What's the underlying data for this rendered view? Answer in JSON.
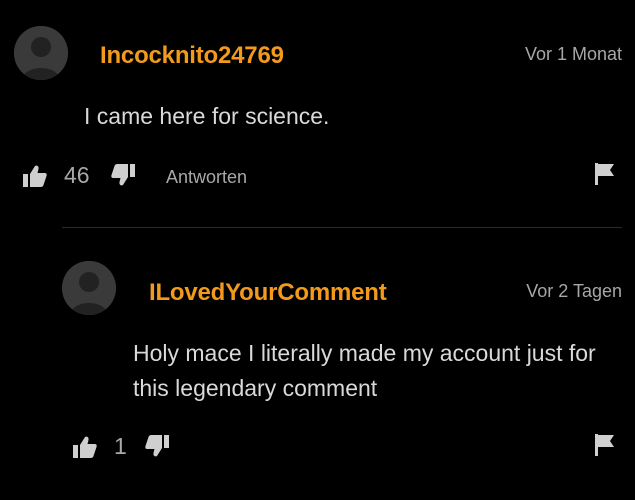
{
  "comments": [
    {
      "username": "Incocknito24769",
      "timestamp": "Vor 1 Monat",
      "text": "I came here for science.",
      "likes": "46",
      "reply_label": "Antworten"
    },
    {
      "username": "ILovedYourComment",
      "timestamp": "Vor 2 Tagen",
      "text": "Holy mace I literally made my account just for this legendary comment",
      "likes": "1"
    }
  ],
  "colors": {
    "background": "#000000",
    "username": "#f39a1c",
    "muted": "#a8a8a8"
  },
  "icons": [
    "avatar-placeholder",
    "thumbs-up-icon",
    "thumbs-down-icon",
    "flag-icon"
  ]
}
